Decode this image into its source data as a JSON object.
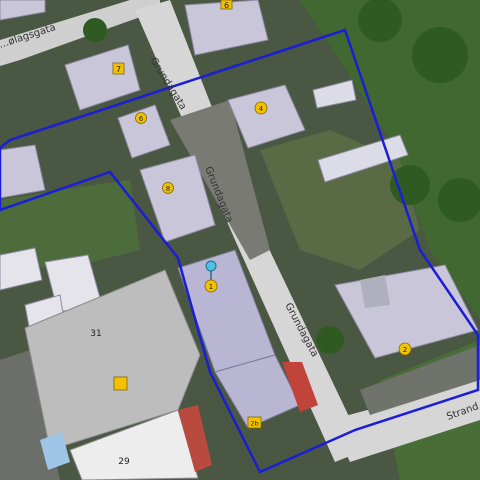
{
  "map": {
    "streets": {
      "grundagata_top": "Grundagata",
      "grundagata_mid": "Grundagata",
      "grundagata_low": "Grundagata",
      "solagsgata": "…ølagsgata",
      "strand": "Strand…"
    },
    "house_numbers": {
      "n6a": "6",
      "n7": "7",
      "n6b": "6",
      "n4": "4",
      "n8": "8",
      "n1": "1",
      "n2b": "2b",
      "n2": "2",
      "n31": "31",
      "n29": "29"
    },
    "colors": {
      "boundary": "#1a1fd6",
      "building": "#c9c6d9",
      "building_selected": "#b9b6d3",
      "marker": "#f2c200",
      "pin": "#4cc3e6",
      "road": "#d9d9d9"
    },
    "icons": {
      "location_pin": "map-pin-icon"
    }
  }
}
